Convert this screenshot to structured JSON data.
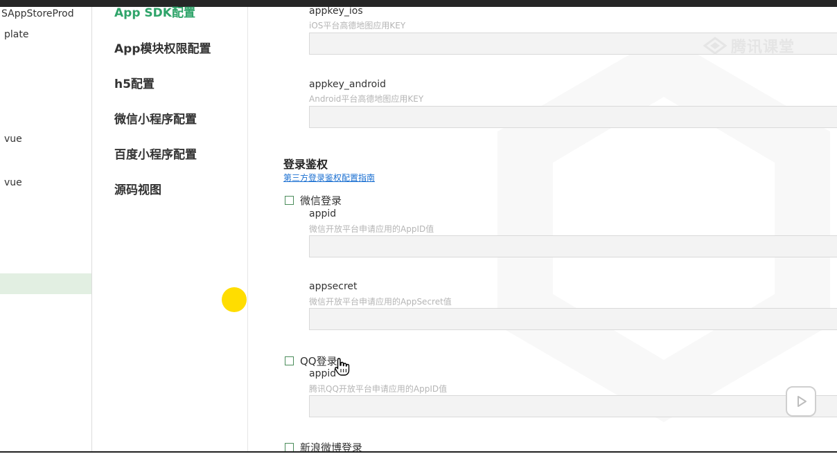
{
  "file_tree": {
    "items": [
      "SAppStoreProd",
      "plate",
      "vue",
      "vue"
    ]
  },
  "nav": {
    "items": [
      {
        "label": "App SDK配置",
        "active": true
      },
      {
        "label": "App模块权限配置"
      },
      {
        "label": "h5配置"
      },
      {
        "label": "微信小程序配置"
      },
      {
        "label": "百度小程序配置"
      },
      {
        "label": "源码视图"
      }
    ]
  },
  "content": {
    "amap": {
      "appkey_ios": {
        "name": "appkey_ios",
        "desc": "iOS平台高德地图应用KEY",
        "value": ""
      },
      "appkey_android": {
        "name": "appkey_android",
        "desc": "Android平台高德地图应用KEY",
        "value": ""
      }
    },
    "login_auth": {
      "title": "登录鉴权",
      "guide_link": "第三方登录鉴权配置指南",
      "wechat": {
        "label": "微信登录",
        "checked": false,
        "appid": {
          "name": "appid",
          "desc": "微信开放平台申请应用的AppID值",
          "value": ""
        },
        "appsecret": {
          "name": "appsecret",
          "desc": "微信开放平台申请应用的AppSecret值",
          "value": ""
        }
      },
      "qq": {
        "label": "QQ登录",
        "checked": false,
        "appid": {
          "name": "appid",
          "desc": "腾讯QQ开放平台申请应用的AppID值",
          "value": ""
        }
      },
      "weibo": {
        "label": "新浪微博登录",
        "checked": false
      }
    }
  },
  "overlay": {
    "watermark_text": "腾讯课堂",
    "play_icon": "play-icon",
    "cursor_icon": "hand-pointer-icon"
  },
  "colors": {
    "accent_green": "#2fa46a",
    "link_blue": "#1a6fd1",
    "highlight_yellow": "#ffdd00"
  }
}
